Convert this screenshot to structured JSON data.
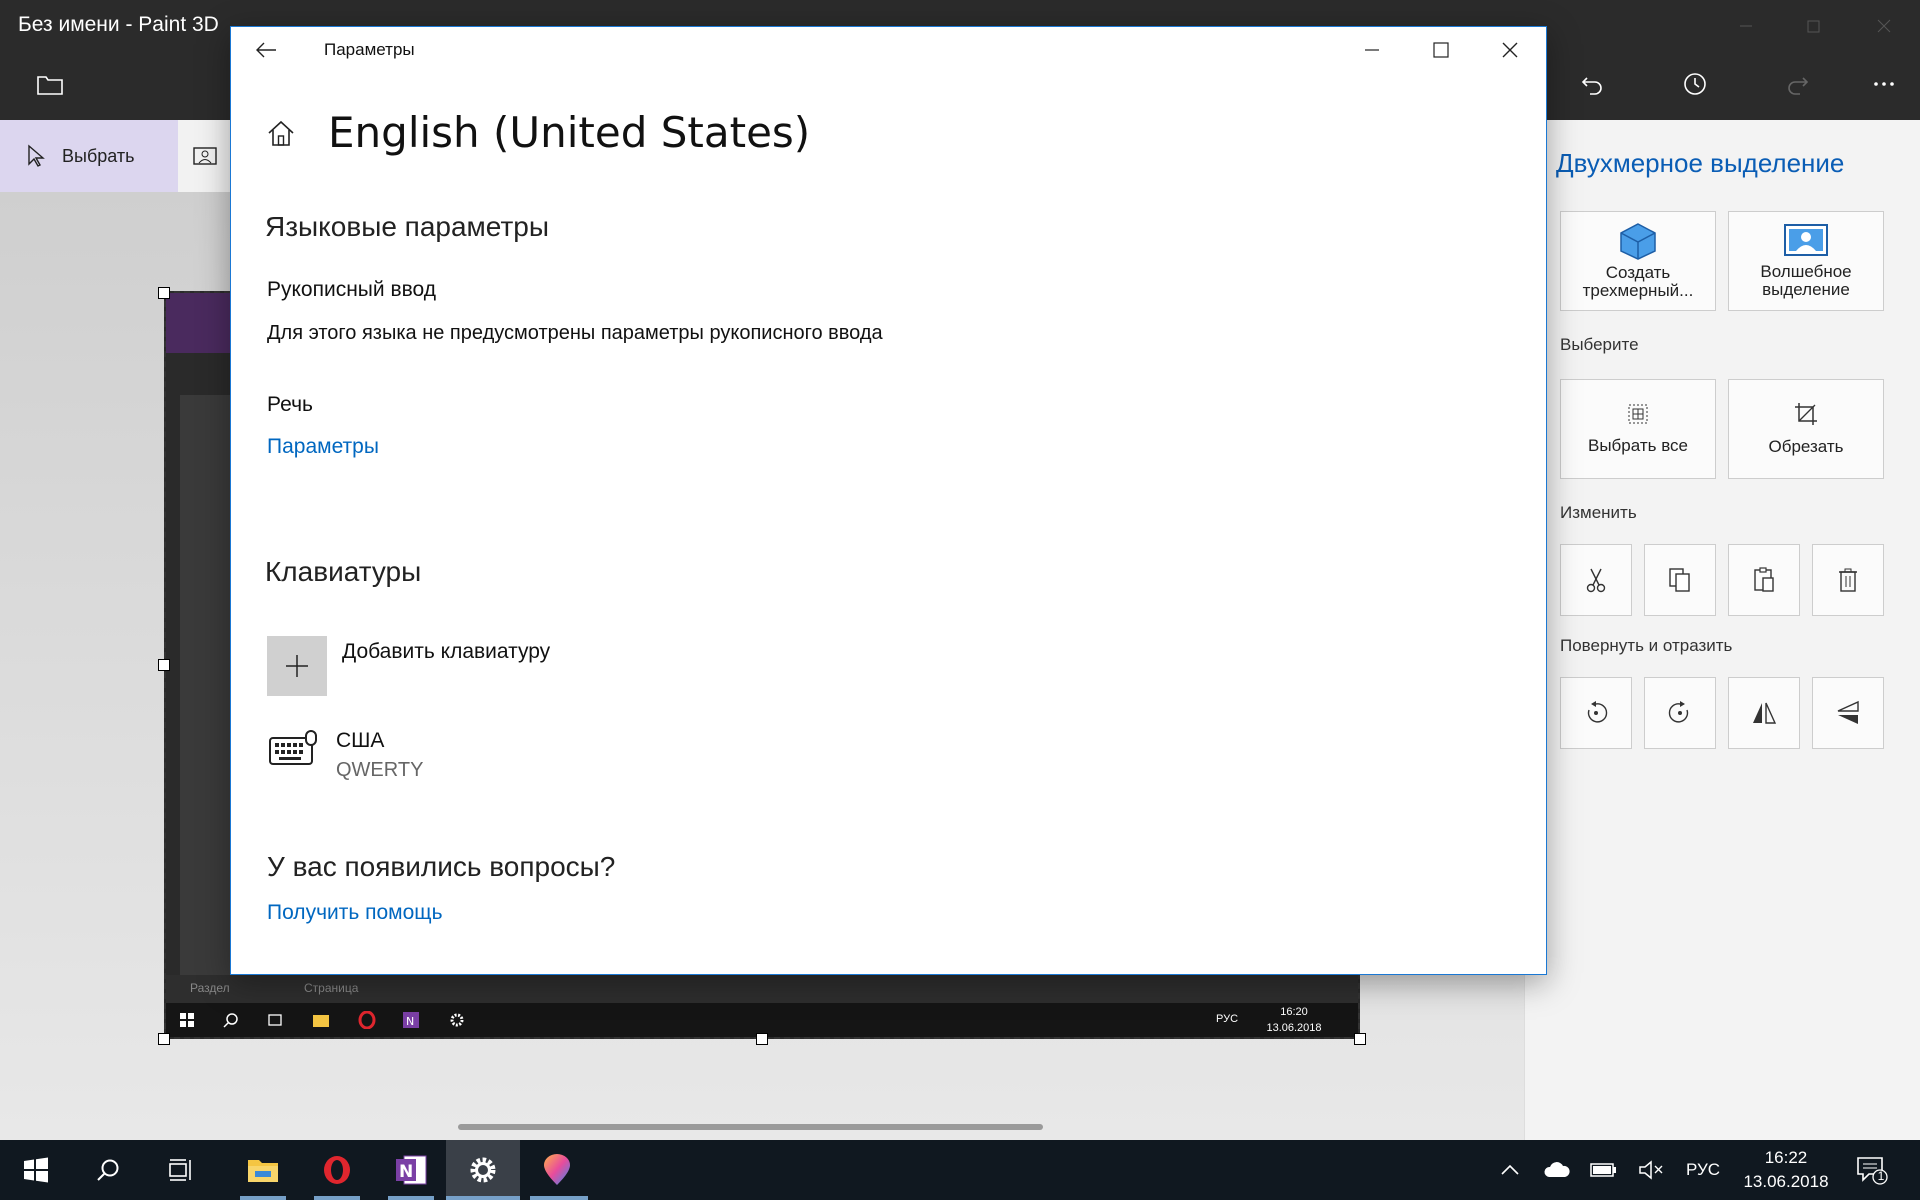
{
  "paint3d": {
    "window_title": "Без имени - Paint 3D",
    "tool_select_label": "Выбрать",
    "side_panel": {
      "title": "Двухмерное выделение",
      "create3d_label": "Создать трехмерный...",
      "magic_select_label": "Волшебное выделение",
      "section_select": "Выберите",
      "select_all_label": "Выбрать все",
      "crop_label": "Обрезать",
      "section_edit": "Изменить",
      "section_rotate": "Повернуть и отразить"
    },
    "pasted_screenshot": {
      "bottom_tabs": [
        "Раздел",
        "Страница"
      ],
      "tray_lang": "РУС",
      "tray_time": "16:20",
      "tray_date": "13.06.2018"
    }
  },
  "settings": {
    "window_title": "Параметры",
    "page_title": "English (United States)",
    "language_section": "Языковые параметры",
    "handwriting_heading": "Рукописный ввод",
    "handwriting_text": "Для этого языка не предусмотрены параметры рукописного ввода",
    "speech_heading": "Речь",
    "speech_link": "Параметры",
    "keyboards_section": "Клавиатуры",
    "add_keyboard_label": "Добавить клавиатуру",
    "keyboard_name": "США",
    "keyboard_layout": "QWERTY",
    "questions_heading": "У вас появились вопросы?",
    "help_link": "Получить помощь"
  },
  "taskbar": {
    "lang": "РУС",
    "time": "16:22",
    "date": "13.06.2018",
    "notification_count": "1"
  }
}
